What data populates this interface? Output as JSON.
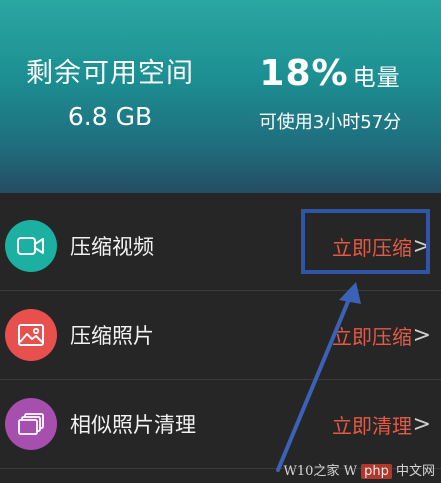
{
  "header": {
    "storage": {
      "title": "剩余可用空间",
      "value": "6.8 GB"
    },
    "battery": {
      "percent": "18%",
      "unit": "电量",
      "subtitle": "可使用3小时57分"
    }
  },
  "list": {
    "items": [
      {
        "label": "压缩视频",
        "action": "立即压缩",
        "icon": "video-camera-icon",
        "color": "#1bb0a2"
      },
      {
        "label": "压缩照片",
        "action": "立即压缩",
        "icon": "image-icon",
        "color": "#e8504d"
      },
      {
        "label": "相似照片清理",
        "action": "立即清理",
        "icon": "photo-stack-icon",
        "color": "#a74fae"
      }
    ],
    "chevron": ">"
  },
  "watermark": {
    "text": "W10之家 W",
    "php": "php",
    "suffix": "中文网"
  },
  "colors": {
    "action": "#e45a45",
    "highlight": "#2f55a6",
    "background": "#262626"
  }
}
